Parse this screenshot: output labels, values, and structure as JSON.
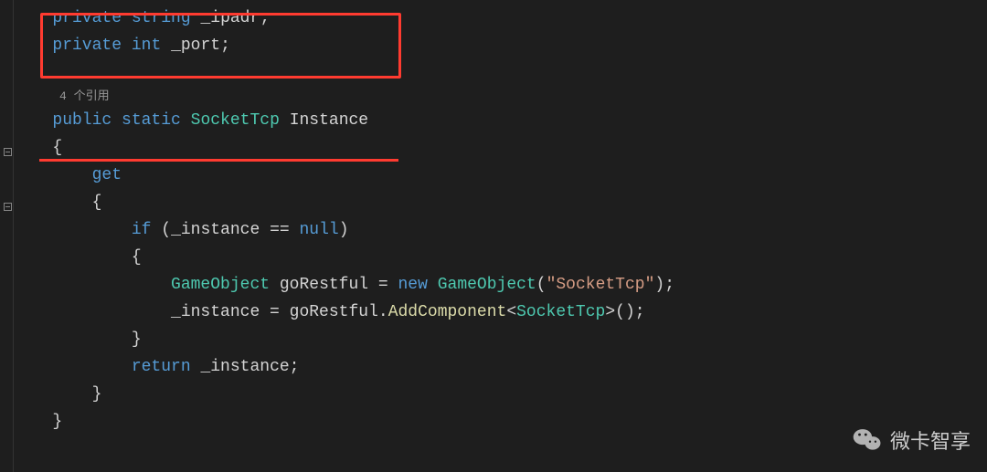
{
  "code": {
    "line1": {
      "kw1": "private",
      "type": "string",
      "field": "_ipadr",
      "semi": ";"
    },
    "line2": {
      "kw1": "private",
      "type": "int",
      "field": "_port",
      "semi": ";"
    },
    "codelens": "4 个引用",
    "line4": {
      "kw1": "public",
      "kw2": "static",
      "type": "SocketTcp",
      "name": "Instance"
    },
    "line5": "{",
    "line6": {
      "kw": "get"
    },
    "line7": "{",
    "line8": {
      "kw_if": "if",
      "lp": "(",
      "field": "_instance",
      "op": " == ",
      "kw_null": "null",
      "rp": ")"
    },
    "line9": "{",
    "line10": {
      "type1": "GameObject",
      "var": "goRestful",
      "eq": " = ",
      "kw_new": "new",
      "type2": "GameObject",
      "lp": "(",
      "str": "\"SocketTcp\"",
      "rp": ")",
      "semi": ";"
    },
    "line11": {
      "field": "_instance",
      "eq": " = ",
      "var": "goRestful",
      "dot": ".",
      "method": "AddComponent",
      "lt": "<",
      "type": "SocketTcp",
      "gt": ">",
      "paren": "()",
      "semi": ";"
    },
    "line12": "}",
    "line13": {
      "kw": "return",
      "field": "_instance",
      "semi": ";"
    },
    "line14": "}",
    "line15": "}"
  },
  "watermark": {
    "text": "微卡智享"
  },
  "colors": {
    "accent": "#ff3b30",
    "bg": "#1e1e1e"
  }
}
